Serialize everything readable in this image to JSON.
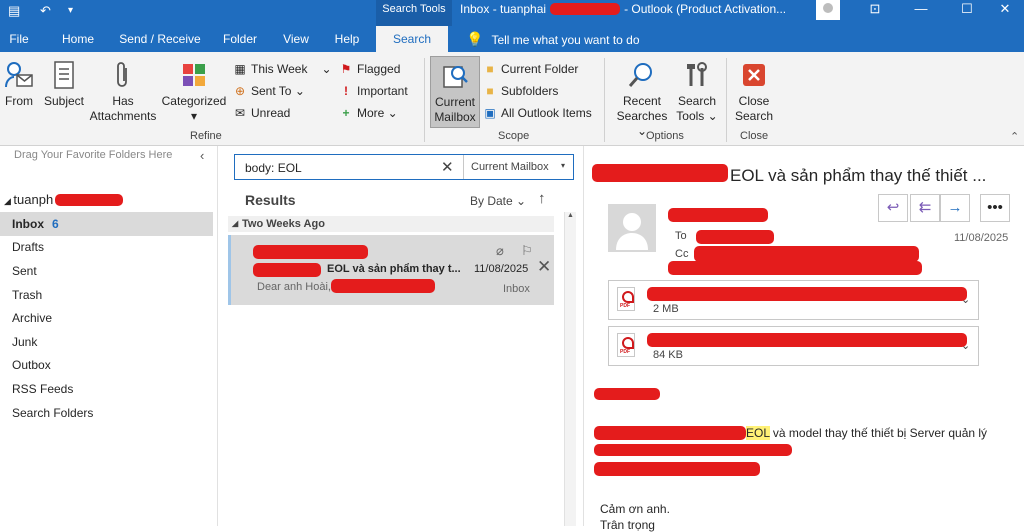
{
  "window": {
    "title": "Inbox - tuanphai",
    "title_suffix": "- Outlook (Product Activation...",
    "search_tools": "Search Tools"
  },
  "tabs": [
    "File",
    "Home",
    "Send / Receive",
    "Folder",
    "View",
    "Help",
    "Search"
  ],
  "active_tab": "Search",
  "tell_me": "Tell me what you want to do",
  "ribbon": {
    "refine": {
      "from": "From",
      "subject": "Subject",
      "has_attachments": "Has Attachments",
      "categorized": "Categorized",
      "this_week": "This Week",
      "sent_to": "Sent To",
      "unread": "Unread",
      "flagged": "Flagged",
      "important": "Important",
      "more": "More",
      "label": "Refine"
    },
    "scope": {
      "current_mailbox": "Current Mailbox",
      "current_folder": "Current Folder",
      "subfolders": "Subfolders",
      "all_outlook_items": "All Outlook Items",
      "label": "Scope"
    },
    "options": {
      "recent_searches": "Recent Searches",
      "search_tools": "Search Tools",
      "label": "Options"
    },
    "close": {
      "close_search": "Close Search",
      "label": "Close"
    }
  },
  "nav": {
    "favorites_hint": "Drag Your Favorite Folders Here",
    "account": "tuanph",
    "folders": [
      {
        "name": "Inbox",
        "count": "6"
      },
      {
        "name": "Drafts"
      },
      {
        "name": "Sent"
      },
      {
        "name": "Trash"
      },
      {
        "name": "Archive"
      },
      {
        "name": "Junk"
      },
      {
        "name": "Outbox"
      },
      {
        "name": "RSS Feeds"
      },
      {
        "name": "Search Folders"
      }
    ]
  },
  "search": {
    "query": "body: EOL",
    "scope": "Current Mailbox"
  },
  "list": {
    "results_label": "Results",
    "sort_label": "By Date",
    "group_label": "Two Weeks Ago",
    "item": {
      "subject": "EOL và sản phẩm thay t...",
      "date": "11/08/2025",
      "preview": "Dear anh Hoài,",
      "folder": "Inbox"
    }
  },
  "reading": {
    "subject": "EOL và sản phẩm thay thế thiết ...",
    "to_label": "To",
    "cc_label": "Cc",
    "date": "11/08/2025",
    "attachments": [
      {
        "size": "2 MB"
      },
      {
        "size": "84 KB"
      }
    ],
    "body_line1": "và model thay thế thiết bị Server quản lý",
    "body_highlight": "EOL",
    "closing1": "Cảm ơn anh.",
    "closing2": "Trân trọng"
  },
  "colors": {
    "accent": "#1f6dbf",
    "redaction": "#e41c1c",
    "highlight": "#fff176"
  }
}
